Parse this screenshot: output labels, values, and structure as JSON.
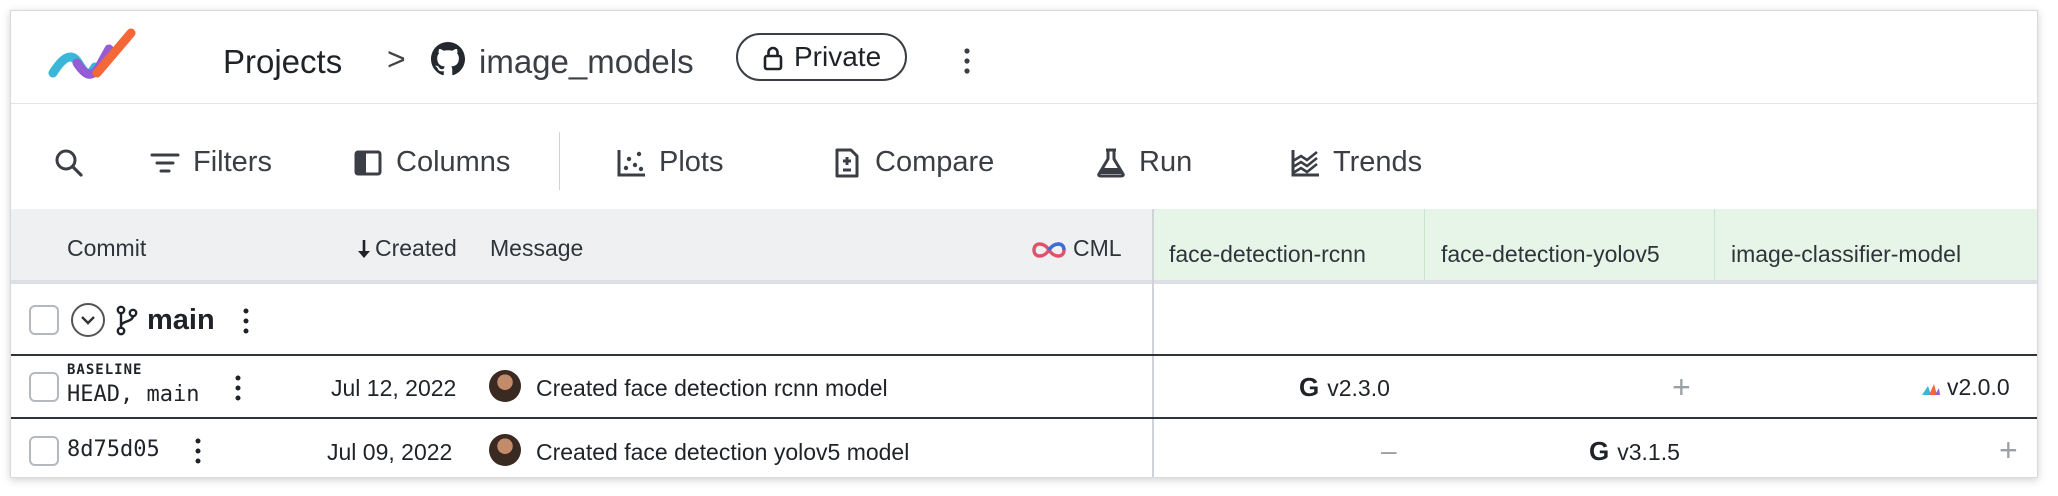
{
  "header": {
    "breadcrumb_projects": "Projects",
    "breadcrumb_separator": ">",
    "repo_name": "image_models",
    "visibility_badge": "Private"
  },
  "toolbar": {
    "filters": "Filters",
    "columns": "Columns",
    "plots": "Plots",
    "compare": "Compare",
    "run": "Run",
    "trends": "Trends"
  },
  "table": {
    "columns": {
      "commit": "Commit",
      "created": "Created",
      "message": "Message",
      "cml": "CML",
      "models": [
        "face-detection-rcnn",
        "face-detection-yolov5",
        "image-classifier-model"
      ]
    },
    "branch": {
      "name": "main"
    },
    "rows": [
      {
        "tag": "BASELINE",
        "commit": "HEAD, main",
        "created": "Jul 12, 2022",
        "message": "Created face detection rcnn model",
        "model_cells": [
          "v2.3.0",
          "+",
          "v2.0.0"
        ]
      },
      {
        "tag": "",
        "commit": "8d75d05",
        "created": "Jul 09, 2022",
        "message": "Created face detection yolov5 model",
        "model_cells": [
          "–",
          "v3.1.5",
          "+"
        ]
      }
    ]
  },
  "icons": {
    "g_glyph": "G",
    "logo": "app-logo",
    "github": "github-icon",
    "lock": "lock-icon"
  },
  "colors": {
    "model_header_bg": "#e6f5e8",
    "logo_blue": "#3ab6d8",
    "logo_purple": "#945dd6",
    "logo_orange": "#f46737"
  }
}
